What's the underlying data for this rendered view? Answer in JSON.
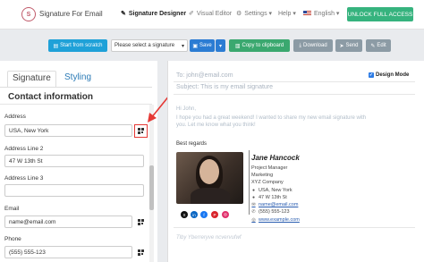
{
  "nav": {
    "brand": "Signature For Email",
    "items": {
      "designer": "Signature Designer",
      "visual_editor": "Visual Editor",
      "settings": "Settings",
      "help": "Help",
      "language": "English"
    },
    "unlock": "UNLOCK FULL ACCESS"
  },
  "toolbar": {
    "start": "Start from scratch",
    "select_placeholder": "Please select a signature",
    "save": "Save",
    "copy": "Copy to clipboard",
    "download": "Download",
    "send": "Send",
    "edit": "Edit"
  },
  "tabs": {
    "signature": "Signature",
    "styling": "Styling"
  },
  "form": {
    "section_title": "Contact information",
    "address_label": "Address",
    "address_value": "USA, New York",
    "address2_label": "Address Line 2",
    "address2_value": "47 W 13th St",
    "address3_label": "Address Line 3",
    "address3_value": "",
    "email_label": "Email",
    "email_value": "name@email.com",
    "phone_label": "Phone",
    "phone_value": "(555) 555-123"
  },
  "preview": {
    "to": "To: john@email.com",
    "subject": "Subject: This is my email signature",
    "design_mode": "Design Mode",
    "body": {
      "greeting": "Hi John,",
      "line1": "I hope you had a great weekend! I wanted to share my new email signature with",
      "line2": "you. Let me know what you think!",
      "best": "Best regards"
    },
    "signature": {
      "name": "Jane Hancock",
      "title": "Project Manager",
      "department": "Marketing",
      "company": "XYZ Company",
      "address": "USA, New York",
      "address2": "47 W 13th St",
      "email": "name@email.com",
      "phone": "(555) 555-123",
      "website": "www.example.com"
    },
    "ps": "Tlby Yberreryve ncvervufwf"
  },
  "colors": {
    "unlock": "#36b37e",
    "start": "#1fa1d8",
    "save": "#2b7cd3",
    "copy": "#3aa86f",
    "gray_btn": "#8c9ba5",
    "link": "#2a5db0",
    "highlight": "#e53935"
  }
}
